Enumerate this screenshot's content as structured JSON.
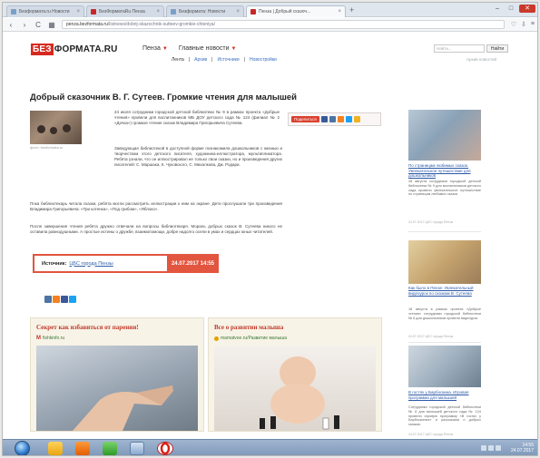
{
  "browser": {
    "tabs": [
      {
        "label": "Безформата.ru Новости",
        "active": false
      },
      {
        "label": "БезФорматаRu Пенза",
        "active": false
      },
      {
        "label": "Безформата: Новости",
        "active": false
      },
      {
        "label": "Пенза | Добрый сказоч...",
        "active": true
      }
    ],
    "new_tab": "+",
    "address_host": "penza.bezformata.ru",
    "address_path": "/listnews/dobrij-skazochnik-sutteev-gromkie-chteniya/",
    "window_controls": {
      "minimize": "–",
      "maximize": "□",
      "close": "✕"
    }
  },
  "site": {
    "logo_highlight": "БЕЗ",
    "logo_rest": "ФОРМАТА.RU",
    "nav": [
      {
        "label": "Пенза",
        "arrow": "▼"
      },
      {
        "label": "Главные новости",
        "arrow": "▼"
      }
    ],
    "subnav": [
      "Лента",
      "|",
      "Архив",
      "|",
      "Источники",
      "|",
      "Новостройки"
    ],
    "search_placeholder": "Найти...",
    "search_button": "Найти",
    "archive_link": "Архив новостей"
  },
  "article": {
    "headline": "Добрый сказочник В. Г. Сутеев. Громкие чтения для малышей",
    "photo_caption": "фото: bezformata.ru",
    "share_button": "Поделиться",
    "paragraphs": [
      "24 июля сотрудники городской детской библиотеки № 9 в рамках проекта «Добрые чтения» провели для воспитанников МБ ДОУ детского сада № 124 (филиал № 2 «Дочка») громкое чтение сказок Владимира Григорьевича Сутеева.",
      "Заведующая библиотекой в доступной форме познакомила дошкольников с жизнью и творчеством этого детского писателя, художника-иллюстратора, мультипликатора. Ребята узнали, что он иллюстрировал не только свои сказки, но и произведения других писателей: С. Маршака, К. Чуковского, С. Михалкова, Дж. Родари.",
      "Пока библиотекарь читала сказки, ребята могли рассмотреть иллюстрации к ним на экране. Дети прослушали три произведения Владимира Григорьевича: «Три котенка», «Под грибом», «Яблоко».",
      "После завершения чтения ребята дружно отвечали на вопросы библиотекаря. Мораль добрых сказок В. Сутеева никого не оставила равнодушными. А простые истины о дружбе, взаимопомощи, добре надолго осели в умах и сердцах юных читателей."
    ],
    "source_label": "Источник:",
    "source_name": "ЦБС города Пензы",
    "source_date": "24.07.2017 14:55"
  },
  "ads": [
    {
      "title": "Секрет как избавиться от парении!",
      "source_mark": "M",
      "source": "fishkinfo.ru"
    },
    {
      "title": "Все о развитии малыша",
      "source_mark": "",
      "source": "mamatvoe.ru/Развитие малыша"
    }
  ],
  "sidebar": [
    {
      "title": "По страницам любимых сказок. Увлекательное путешествие для дошкольников",
      "text": "28 августа сотрудники городской детской библиотеки № 9 для воспитанников детского сада провели увлекательное путешествие по страницам любимых сказок.",
      "meta": "24.07.2017 ЦБС города Пензы"
    },
    {
      "title": "Как было в Пензе: Увлекательный видеоурок по сказкам В. Сутеева",
      "text": "18 августа в рамках проекта «Добрые чтения» сотрудники городской библиотеки № 6 для дошкольников провели видеоурок.",
      "meta": "24.07.2017 ЦБС города Пензы"
    },
    {
      "title": "В гостях у Барбоскина. Игровая программа для малышей",
      "text": "Сотрудники городской детской библиотеки № 8 для малышей детского сада № 124 провели игровую программу «В гостях у Барбоскиных» и рассказали о добрых сказках.",
      "meta": "24.07.2017 ЦБС города Пензы"
    }
  ],
  "taskbar": {
    "clock": "14:55",
    "date": "24.07.2017"
  },
  "colors": {
    "brand_red": "#d62a1f",
    "link_blue": "#2b59a8",
    "taskbar": "#8aa3c2"
  }
}
